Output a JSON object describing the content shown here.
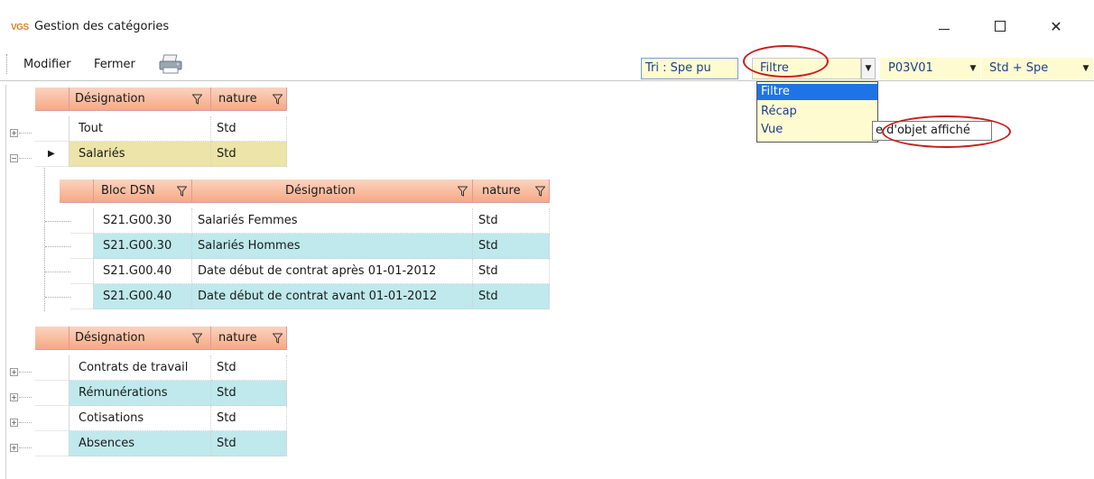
{
  "window": {
    "logo": "VGS",
    "title": "Gestion des catégories",
    "minimize_icon": "minimize-icon",
    "maximize_icon": "maximize-icon",
    "close_symbol": "✕"
  },
  "toolbar": {
    "modifier_label": "Modifier",
    "fermer_label": "Fermer",
    "print_icon": "printer-icon",
    "sort_label": "Tri : Spe pu",
    "view_mode_value": "Filtre",
    "version_value": "P03V01",
    "scope_value": "Std + Spe"
  },
  "dropdown": {
    "options": [
      "Filtre",
      "Récap",
      "Vue"
    ],
    "selected": "Filtre"
  },
  "tooltip": {
    "text": "e d'objet affiché"
  },
  "grid_top": {
    "headers": [
      "Désignation",
      "nature"
    ],
    "rows": [
      {
        "designation": "Tout",
        "nature": "Std"
      },
      {
        "designation": "Salariés",
        "nature": "Std"
      }
    ]
  },
  "grid_sub": {
    "headers": [
      "Bloc DSN",
      "Désignation",
      "nature"
    ],
    "rows": [
      {
        "bloc": "S21.G00.30",
        "designation": "Salariés Femmes",
        "nature": "Std"
      },
      {
        "bloc": "S21.G00.30",
        "designation": "Salariés Hommes",
        "nature": "Std"
      },
      {
        "bloc": "S21.G00.40",
        "designation": "Date début de contrat après 01-01-2012",
        "nature": "Std"
      },
      {
        "bloc": "S21.G00.40",
        "designation": "Date début de contrat avant 01-01-2012",
        "nature": "Std"
      }
    ]
  },
  "grid_bottom": {
    "headers": [
      "Désignation",
      "nature"
    ],
    "rows": [
      {
        "designation": "Contrats de travail",
        "nature": "Std"
      },
      {
        "designation": "Rémunérations",
        "nature": "Std"
      },
      {
        "designation": "Cotisations",
        "nature": "Std"
      },
      {
        "designation": "Absences",
        "nature": "Std"
      }
    ]
  },
  "colors": {
    "header_gradient_top": "#fbd3bf",
    "header_gradient_bottom": "#f6a985",
    "alt_row": "#bfe9ec",
    "selected_row": "#ece4a8",
    "combo_bg": "#fffbd1",
    "annotation": "#c81c1c"
  }
}
